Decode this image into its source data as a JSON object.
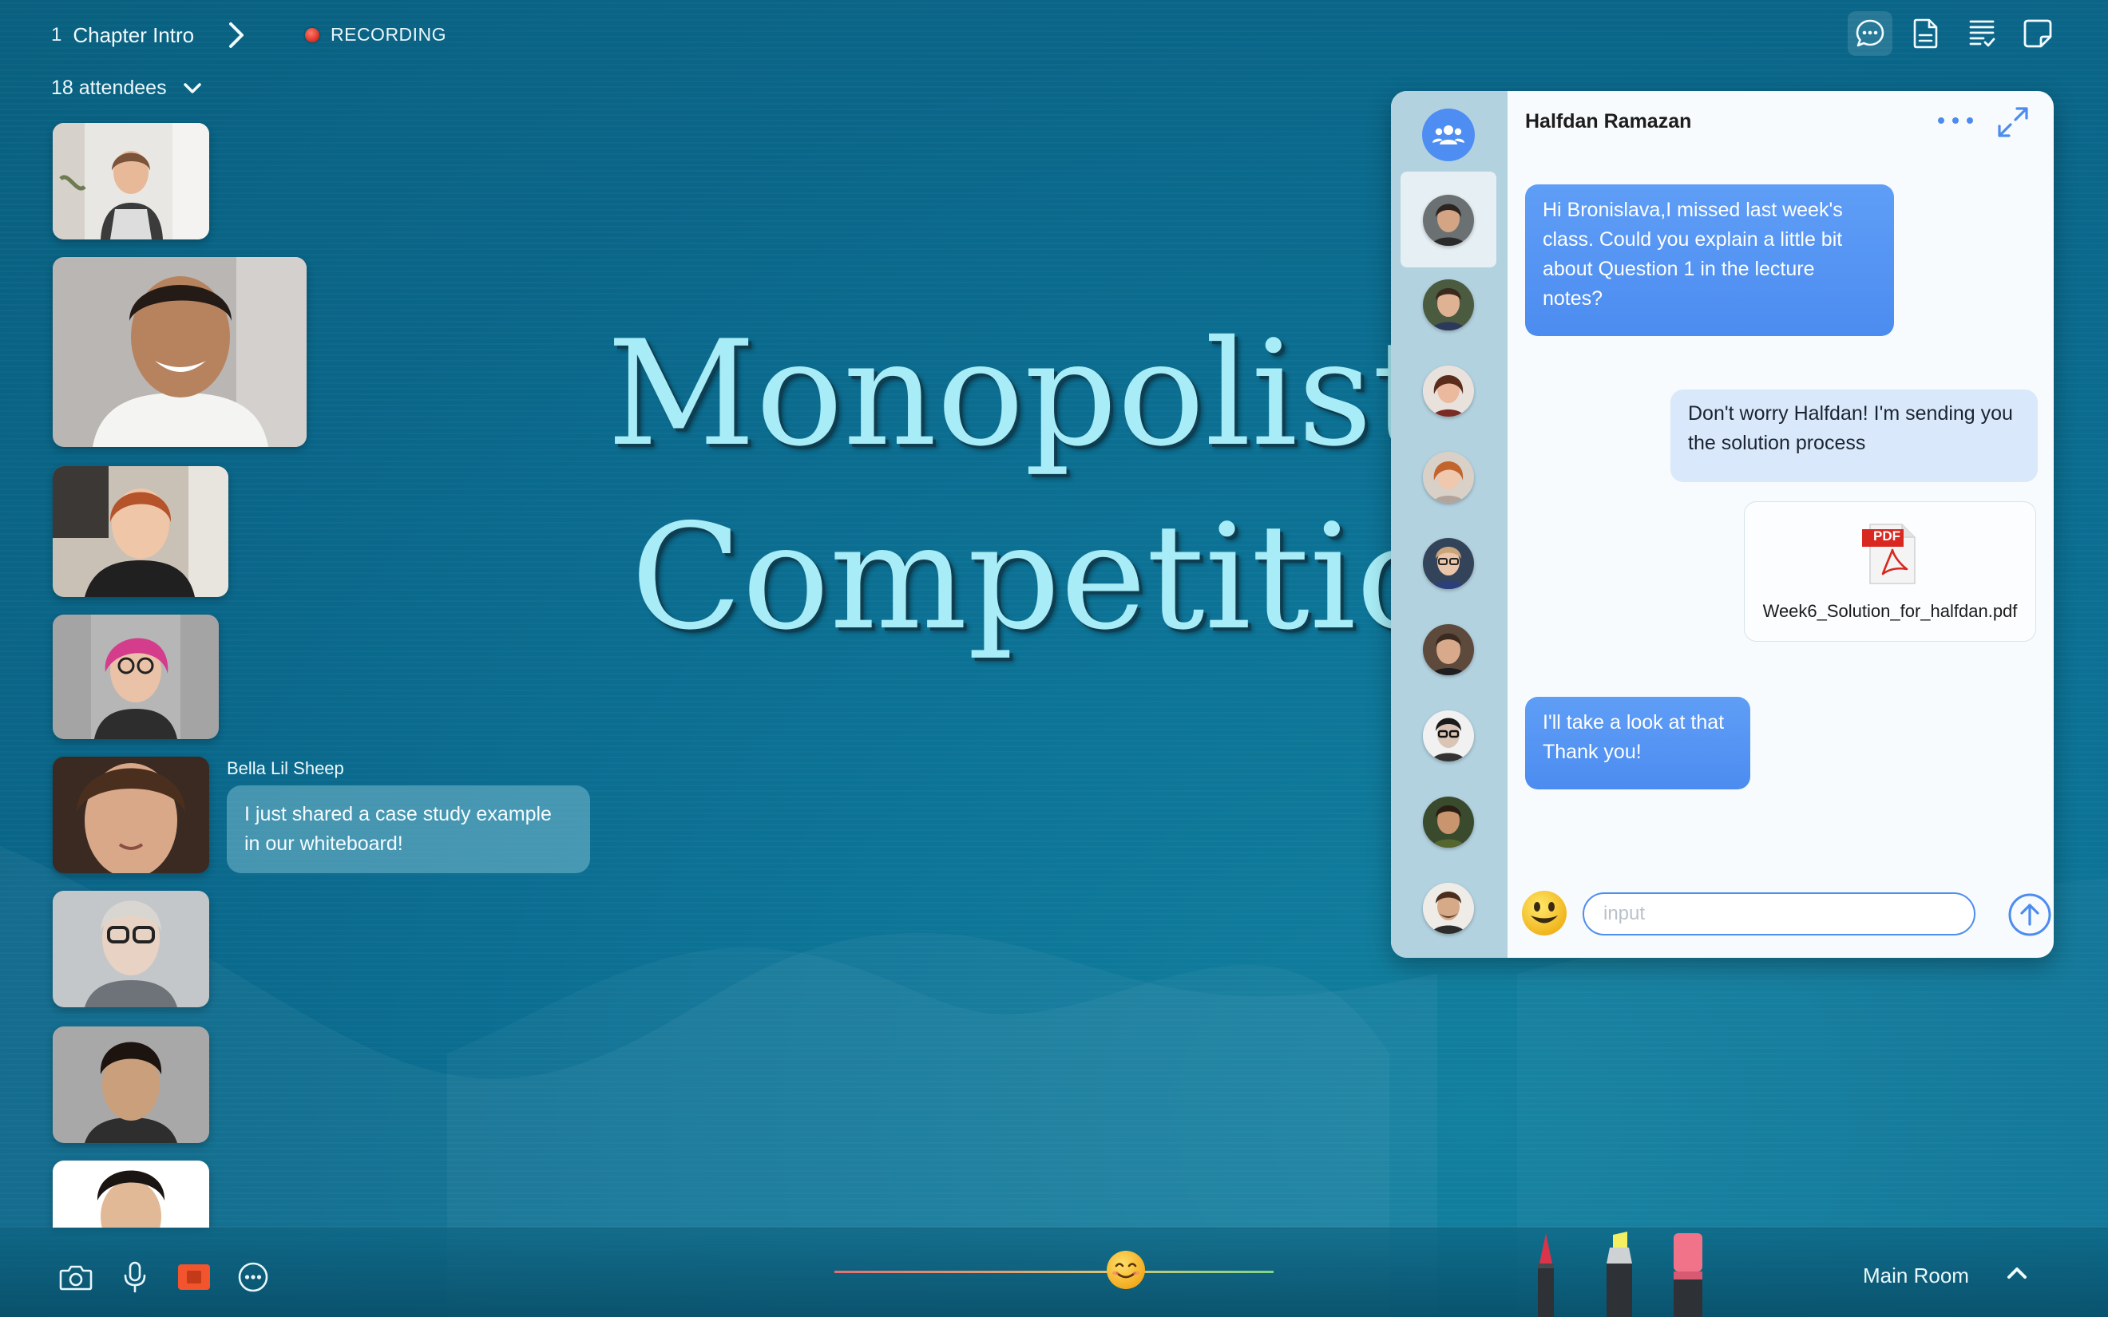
{
  "header": {
    "chapter_number": "1",
    "chapter_title": "Chapter Intro",
    "recording_label": "RECORDING",
    "attendees_label": "18 attendees",
    "toolbar_icons": [
      "chat-icon",
      "document-icon",
      "checklist-icon",
      "note-icon"
    ]
  },
  "slide": {
    "line1": "Monopolistic",
    "line2": "Competition"
  },
  "attendee_chat": {
    "name": "Bella Lil Sheep",
    "message": "I just shared a case study example in our whiteboard!"
  },
  "chat": {
    "contact_name": "Halfdan Ramazan",
    "messages": [
      {
        "direction": "in",
        "text": "Hi Bronislava,I missed last week's class. Could you explain a little bit about Question 1 in the lecture notes?"
      },
      {
        "direction": "out",
        "text": "Don't worry Halfdan! I'm sending you the solution process"
      },
      {
        "direction": "in",
        "text": "I'll take a look at that Thank you!"
      }
    ],
    "attachment": {
      "file_name": "Week6_Solution_for_halfdan.pdf",
      "badge": "PDF"
    },
    "input_placeholder": "input"
  },
  "bottom": {
    "icons": [
      "camera-icon",
      "microphone-icon",
      "screen-share-icon",
      "more-icon"
    ],
    "room_label": "Main Room"
  },
  "colors": {
    "accent": "#4c8cf0",
    "background": "#0b6f93",
    "recording": "#d72e20",
    "slide_text": "#a7ecf6"
  }
}
